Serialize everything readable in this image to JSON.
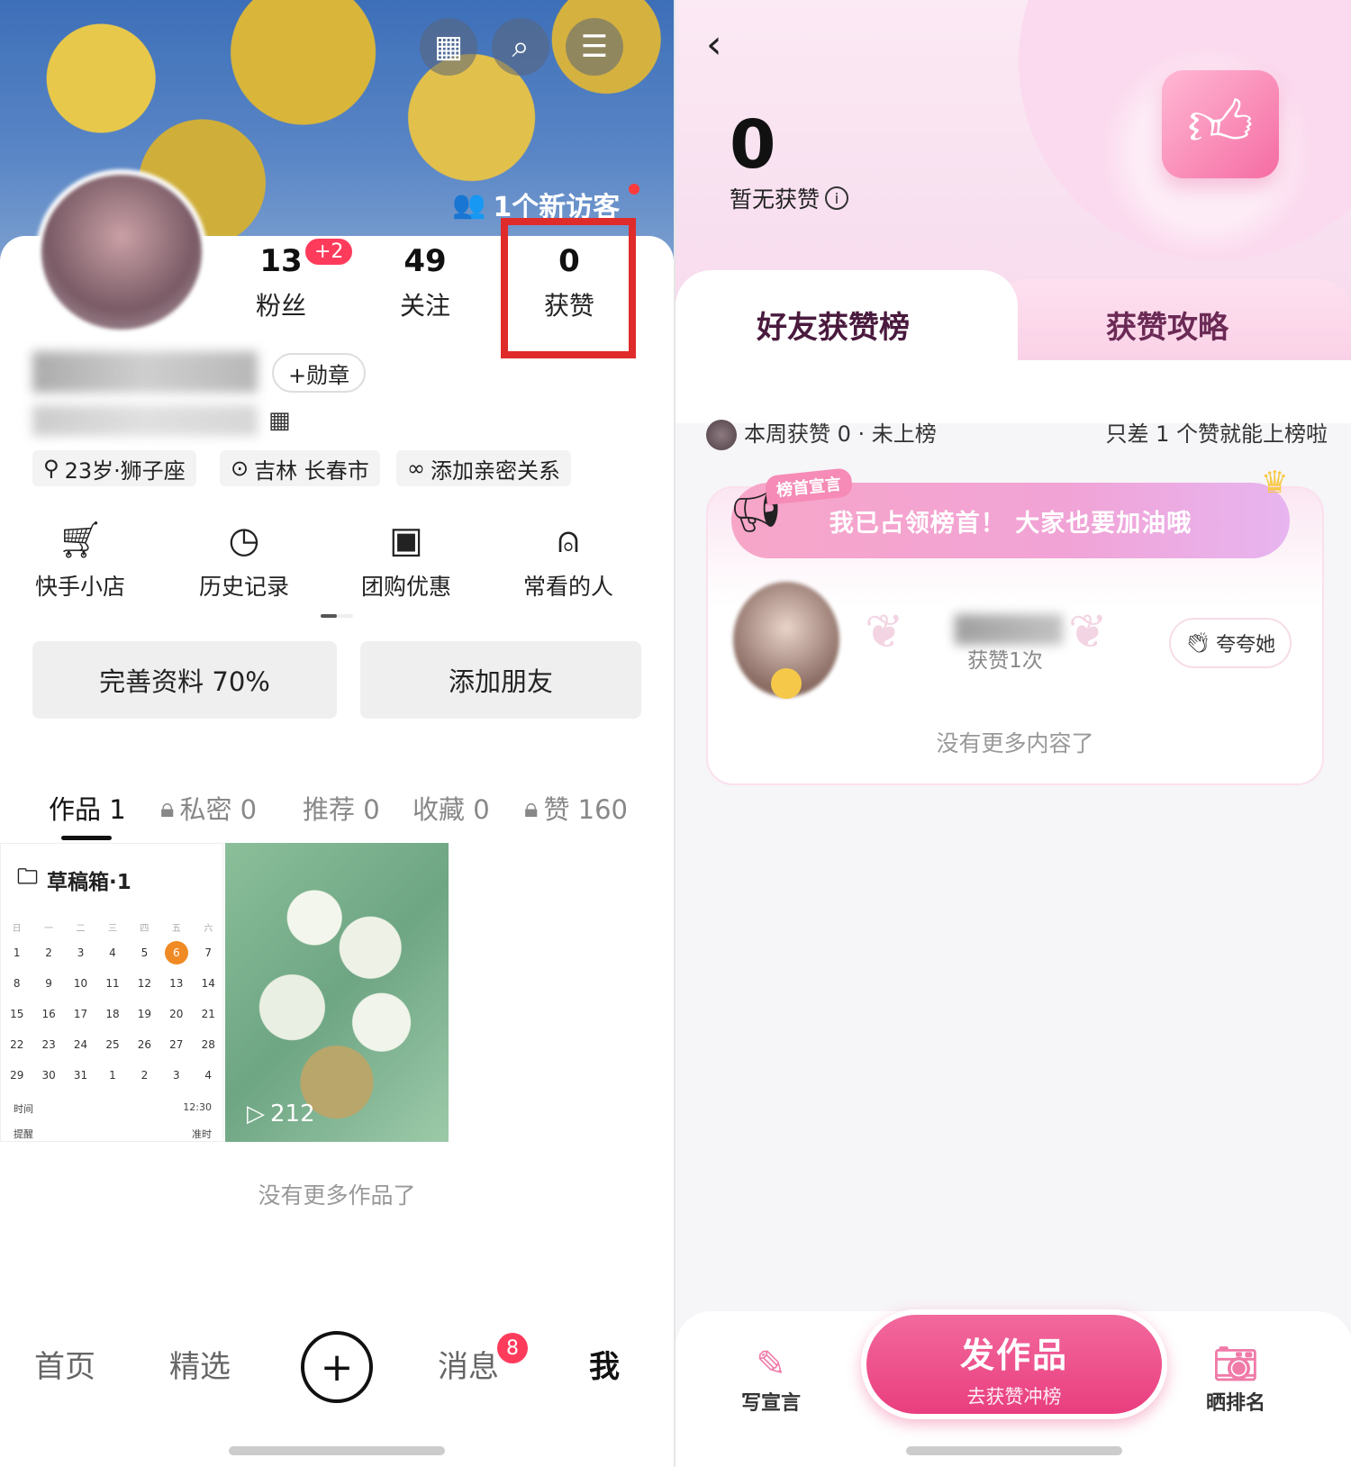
{
  "left": {
    "header_icons": [
      "calendar-icon",
      "search-icon",
      "menu-icon"
    ],
    "visitor_text": "1个新访客",
    "stats": [
      {
        "value": "13",
        "label": "粉丝",
        "badge": "+2"
      },
      {
        "value": "49",
        "label": "关注"
      },
      {
        "value": "0",
        "label": "获赞"
      }
    ],
    "medal_button": "+勋章",
    "tags": [
      "23岁·狮子座",
      "吉林 长春市",
      "添加亲密关系"
    ],
    "tools": [
      {
        "label": "快手小店",
        "icon": "cart-icon"
      },
      {
        "label": "历史记录",
        "icon": "clock-icon"
      },
      {
        "label": "团购优惠",
        "icon": "group-buy-icon"
      },
      {
        "label": "常看的人",
        "icon": "person-icon"
      }
    ],
    "buttons": {
      "complete_profile": "完善资料 70%",
      "add_friend": "添加朋友"
    },
    "tabs": [
      {
        "label": "作品 1",
        "locked": false
      },
      {
        "label": "私密 0",
        "locked": true
      },
      {
        "label": "推荐 0",
        "locked": false
      },
      {
        "label": "收藏 0",
        "locked": false
      },
      {
        "label": "赞 160",
        "locked": true
      }
    ],
    "draft": {
      "title": "草稿箱·1",
      "weekdays": [
        "日",
        "一",
        "二",
        "三",
        "四",
        "五",
        "六"
      ],
      "weeks": [
        [
          "1",
          "2",
          "3",
          "4",
          "5",
          "6",
          "7"
        ],
        [
          "8",
          "9",
          "10",
          "11",
          "12",
          "13",
          "14"
        ],
        [
          "15",
          "16",
          "17",
          "18",
          "19",
          "20",
          "21"
        ],
        [
          "22",
          "23",
          "24",
          "25",
          "26",
          "27",
          "28"
        ],
        [
          "29",
          "30",
          "31",
          "1",
          "2",
          "3",
          "4"
        ]
      ],
      "today": "6",
      "time_label": "时间",
      "time_value": "12:30",
      "remind_label": "提醒",
      "remind_value": "准时"
    },
    "video_play_count": "212",
    "no_more": "没有更多作品了",
    "nav": {
      "home": "首页",
      "featured": "精选",
      "plus": "+",
      "messages": "消息",
      "messages_badge": "8",
      "me": "我"
    }
  },
  "right": {
    "likes_count": "0",
    "likes_sub": "暂无获赞",
    "tabs": {
      "active": "好友获赞榜",
      "inactive": "获赞攻略"
    },
    "week_text": "本周获赞 0 · 未上榜",
    "hint_text": "只差 1 个赞就能上榜啦",
    "banner_tag": "榜首宣言",
    "banner_text": "我已占领榜首！ 大家也要加油哦",
    "rank_likes": "获赞1次",
    "praise_button": "夸夸她",
    "no_more": "没有更多内容了",
    "actions": {
      "write": "写宣言",
      "share": "晒排名"
    },
    "publish": {
      "main": "发作品",
      "sub": "去获赞冲榜"
    }
  }
}
